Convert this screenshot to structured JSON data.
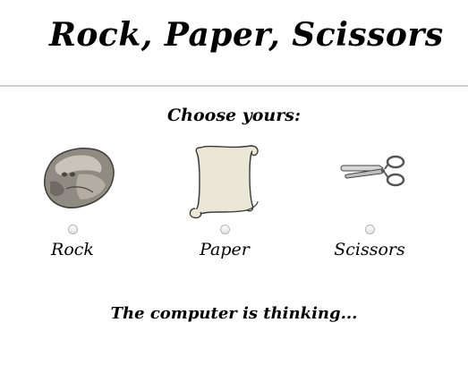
{
  "app": {
    "title": "Rock, Paper, Scissors"
  },
  "prompt": "Choose yours:",
  "choices": [
    {
      "label": "Rock",
      "icon": "rock-icon",
      "selected": false
    },
    {
      "label": "Paper",
      "icon": "paper-scroll-icon",
      "selected": false
    },
    {
      "label": "Scissors",
      "icon": "scissors-icon",
      "selected": false
    }
  ],
  "status": "The computer is thinking..."
}
